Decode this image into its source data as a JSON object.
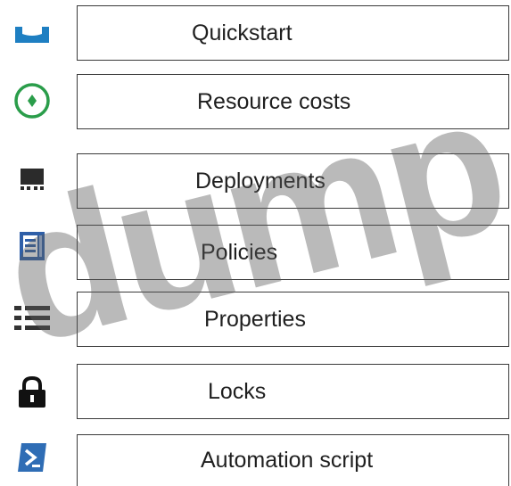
{
  "menu": {
    "items": [
      {
        "label": "Quickstart",
        "icon": "quickstart-icon"
      },
      {
        "label": "Resource costs",
        "icon": "resource-costs-icon"
      },
      {
        "label": "Deployments",
        "icon": "deployments-icon"
      },
      {
        "label": "Policies",
        "icon": "policies-icon"
      },
      {
        "label": "Properties",
        "icon": "properties-icon"
      },
      {
        "label": "Locks",
        "icon": "lock-icon"
      },
      {
        "label": "Automation script",
        "icon": "automation-script-icon"
      }
    ]
  },
  "watermark": {
    "text": "dump."
  },
  "colors": {
    "quickstart": "#1e7fc2",
    "resource_costs": "#2a9d4a",
    "deployments": "#2b2b2b",
    "policies": "#2f5fa8",
    "properties": "#333333",
    "locks": "#111111",
    "automation": "#2f6db5"
  }
}
